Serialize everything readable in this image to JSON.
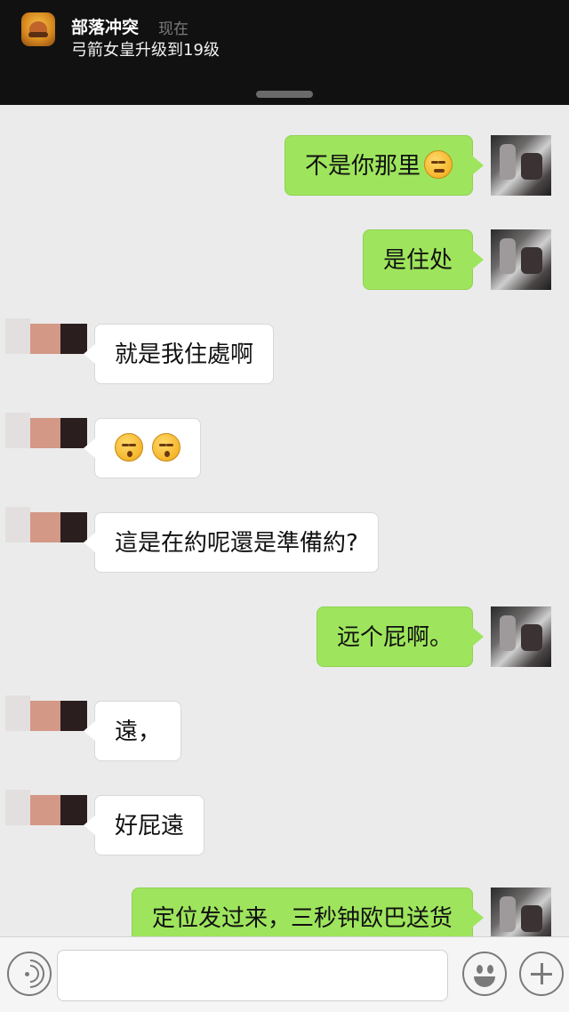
{
  "notification": {
    "app_name": "部落冲突",
    "time": "现在",
    "message": "弓箭女皇升级到19级",
    "app_icon": "clash-of-clans-app-icon"
  },
  "messages": [
    {
      "sender": "self",
      "text": "不是你那里",
      "emoji": [
        "unamused"
      ]
    },
    {
      "sender": "self",
      "text": "是住处"
    },
    {
      "sender": "other",
      "text": "就是我住處啊"
    },
    {
      "sender": "other",
      "text": "",
      "emoji": [
        "kissing",
        "kissing"
      ]
    },
    {
      "sender": "other",
      "text": "這是在約呢還是準備約?"
    },
    {
      "sender": "self",
      "text": "远个屁啊。"
    },
    {
      "sender": "other",
      "text": "遠，"
    },
    {
      "sender": "other",
      "text": "好屁遠"
    },
    {
      "sender": "self",
      "text": "定位发过来，三秒钟欧巴送货"
    }
  ],
  "input_bar": {
    "voice_icon": "voice-icon",
    "text_value": "",
    "emoji_icon": "emoji-smile-icon",
    "more_icon": "plus-icon"
  },
  "colors": {
    "self_bubble": "#9ee55d",
    "other_bubble": "#ffffff",
    "chat_background": "#ebebeb",
    "notification_background": "#111111"
  }
}
